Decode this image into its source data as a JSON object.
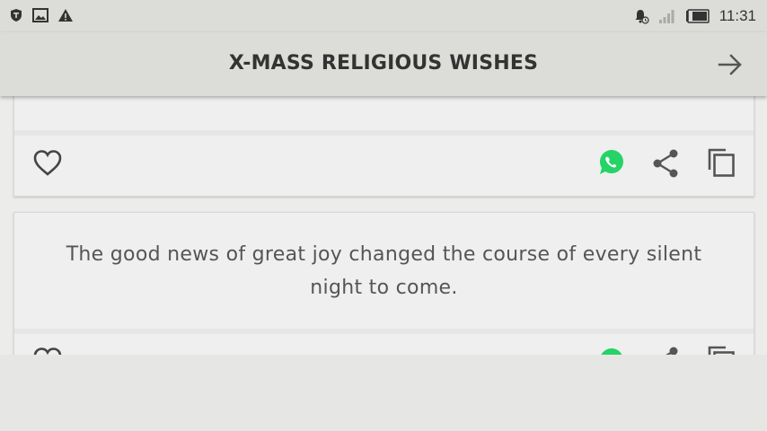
{
  "status_bar": {
    "left_icons": [
      "shield-icon",
      "image-icon",
      "warning-icon"
    ],
    "right_icons": [
      "alarm-bell-icon",
      "signal-icon",
      "battery-icon"
    ],
    "time": "11:31"
  },
  "app_bar": {
    "title": "X-MASS RELIGIOUS WISHES",
    "next_icon": "arrow-right-icon"
  },
  "cards": [
    {
      "text": "",
      "actions": [
        "heart-icon",
        "whatsapp-icon",
        "share-icon",
        "copy-icon"
      ]
    },
    {
      "text": "The good news of great joy changed the course of every silent night to come.",
      "actions": [
        "heart-icon",
        "whatsapp-icon",
        "share-icon",
        "copy-icon"
      ]
    }
  ],
  "colors": {
    "app_bar": "#dcdcd8",
    "card": "#efefef",
    "whatsapp": "#25d366",
    "icon": "#444444",
    "text": "#555555"
  }
}
